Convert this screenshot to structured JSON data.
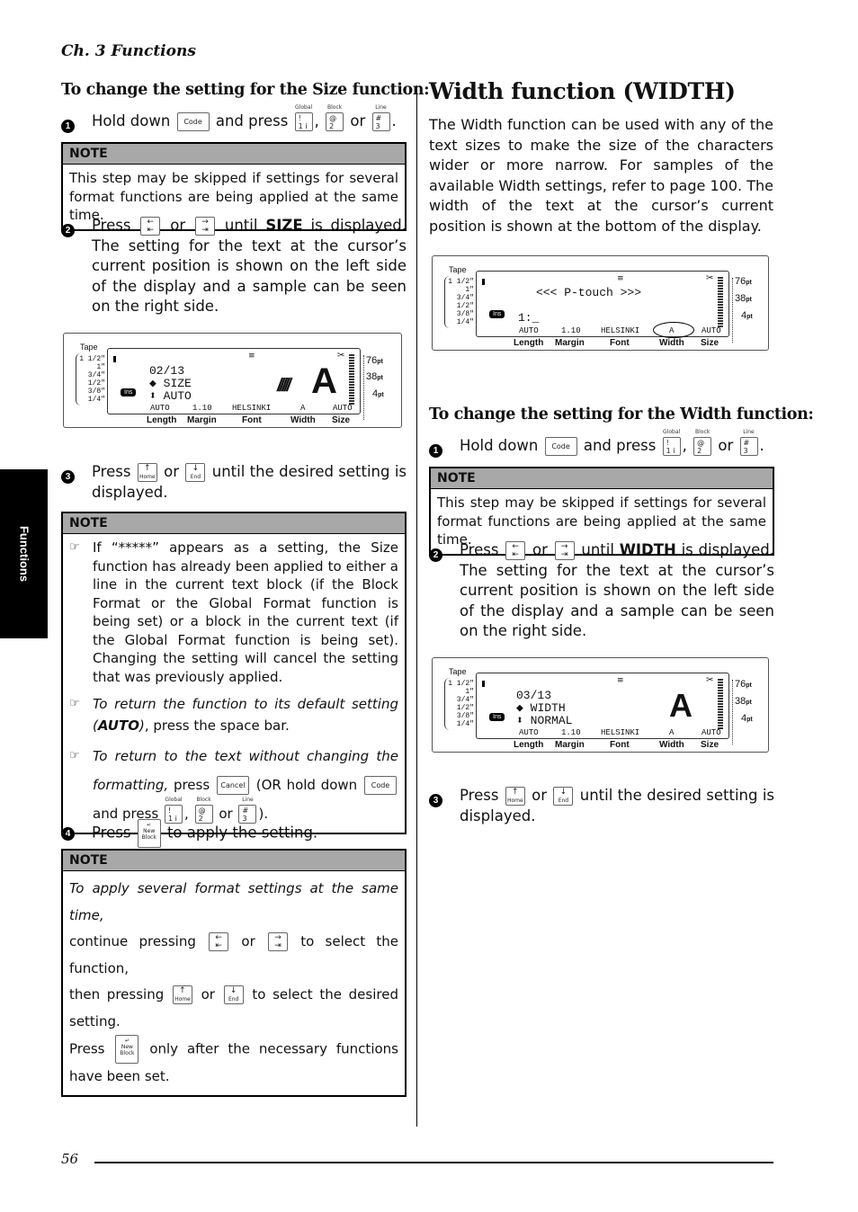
{
  "header": {
    "chapter": "Ch. 3 Functions"
  },
  "side_tab": {
    "label": "Functions"
  },
  "footer": {
    "page_number": "56"
  },
  "left": {
    "heading": "To change the setting for the Size function:",
    "step1": {
      "num": "1",
      "pre": "Hold down",
      "mid": "and press",
      "sep": ",",
      "or": "or",
      "end": "."
    },
    "note1": {
      "title": "NOTE",
      "text": "This step may be skipped if settings for several format functions are being applied at the same time."
    },
    "step2": {
      "num": "2",
      "pre": "Press",
      "or": "or",
      "until": "until",
      "bold": "SIZE",
      "post": "is displayed. The setting for the text at the cursor’s current position is shown on the left side of the display and a sample can be seen on the right side."
    },
    "display": {
      "tape_label": "Tape",
      "tape_sizes": [
        "1 1/2\"",
        "1\"",
        "3/4\"",
        "1/2\"",
        "3/8\"",
        "1/4\""
      ],
      "line1": "02/13",
      "line2": "SIZE",
      "line3": "AUTO",
      "ins": "Ins",
      "status": [
        "AUTO",
        "1.10",
        "HELSINKI",
        "A",
        "AUTO"
      ],
      "labels": [
        "Length",
        "Margin",
        "Font",
        "Width",
        "Size"
      ],
      "pt_scale": [
        "76",
        "38",
        "4"
      ],
      "pt_unit": "pt",
      "sample_char": "A"
    },
    "step3": {
      "num": "3",
      "pre": "Press",
      "or": "or",
      "post": "until the desired setting is displayed."
    },
    "note2": {
      "title": "NOTE",
      "item1": "If “*****” appears as a setting, the Size function has already been applied to either a line in the current text block (if the Block Format or the Global Format function is being set) or a block in the current text (if the Global Format function is being set). Changing the setting will cancel the setting that was previously applied.",
      "item2_italic": "To return the function to its default setting (",
      "item2_bold": "AUTO",
      "item2_close": ")",
      "item2_rest": ", press the space bar.",
      "item3_italic": "To return to the text without changing the formatting,",
      "item3_press": "press",
      "item3_or_hold": "(OR hold down",
      "item3_and": "and press",
      "item3_sep": ",",
      "item3_or": "or",
      "item3_end": ")."
    },
    "step4": {
      "num": "4",
      "pre": "Press",
      "post": "to apply the setting."
    },
    "note3": {
      "title": "NOTE",
      "line1": "To apply several format settings at the same time,",
      "line2_pre": "continue pressing",
      "line2_or": "or",
      "line2_post": "to select the function,",
      "line3_pre": "then pressing",
      "line3_or": "or",
      "line3_post": "to select the desired setting.",
      "line4_pre": "Press",
      "line4_post": "only after the necessary functions have been set."
    }
  },
  "right": {
    "title": "Width function (WIDTH)",
    "intro": "The Width function can be used with any of the text sizes to make the size of the characters wider or more narrow. For samples of the available Width settings, refer to page 100. The width of the text at the cursor’s current position is shown at the bottom of the display.",
    "display1": {
      "tape_label": "Tape",
      "tape_sizes": [
        "1 1/2\"",
        "1\"",
        "3/4\"",
        "1/2\"",
        "3/8\"",
        "1/4\""
      ],
      "line1": "<<< P-touch >>>",
      "line2": "1:_",
      "ins": "Ins",
      "status": [
        "AUTO",
        "1.10",
        "HELSINKI",
        "A",
        "AUTO"
      ],
      "labels": [
        "Length",
        "Margin",
        "Font",
        "Width",
        "Size"
      ],
      "pt_scale": [
        "76",
        "38",
        "4"
      ],
      "pt_unit": "pt"
    },
    "heading": "To change the setting for the Width function:",
    "step1": {
      "num": "1",
      "pre": "Hold down",
      "mid": "and press",
      "sep": ",",
      "or": "or",
      "end": "."
    },
    "note1": {
      "title": "NOTE",
      "text": "This step may be skipped if settings for several format functions are being applied at the same time."
    },
    "step2": {
      "num": "2",
      "pre": "Press",
      "or": "or",
      "until": "until",
      "bold": "WIDTH",
      "post": "is displayed. The setting for the text at the cursor’s current position is shown on the left side of the display and a sample can be seen on the right side."
    },
    "display2": {
      "tape_label": "Tape",
      "tape_sizes": [
        "1 1/2\"",
        "1\"",
        "3/4\"",
        "1/2\"",
        "3/8\"",
        "1/4\""
      ],
      "line1": "03/13",
      "line2": "WIDTH",
      "line3": "NORMAL",
      "ins": "Ins",
      "status": [
        "AUTO",
        "1.10",
        "HELSINKI",
        "A",
        "AUTO"
      ],
      "labels": [
        "Length",
        "Margin",
        "Font",
        "Width",
        "Size"
      ],
      "pt_scale": [
        "76",
        "38",
        "4"
      ],
      "pt_unit": "pt",
      "sample_char": "A"
    },
    "step3": {
      "num": "3",
      "pre": "Press",
      "or": "or",
      "post": "until the desired setting is displayed."
    }
  },
  "keys": {
    "code": "Code",
    "cancel": "Cancel",
    "global_cap": "Global",
    "block_cap": "Block",
    "line_cap": "Line",
    "k1": "! 1 i",
    "k2": "@ 2",
    "k3": "# 3",
    "left": "←",
    "right": "→",
    "home": "Home",
    "end": "End",
    "up": "↑",
    "down": "↓",
    "newblock": "New Block",
    "enter": "↵"
  }
}
